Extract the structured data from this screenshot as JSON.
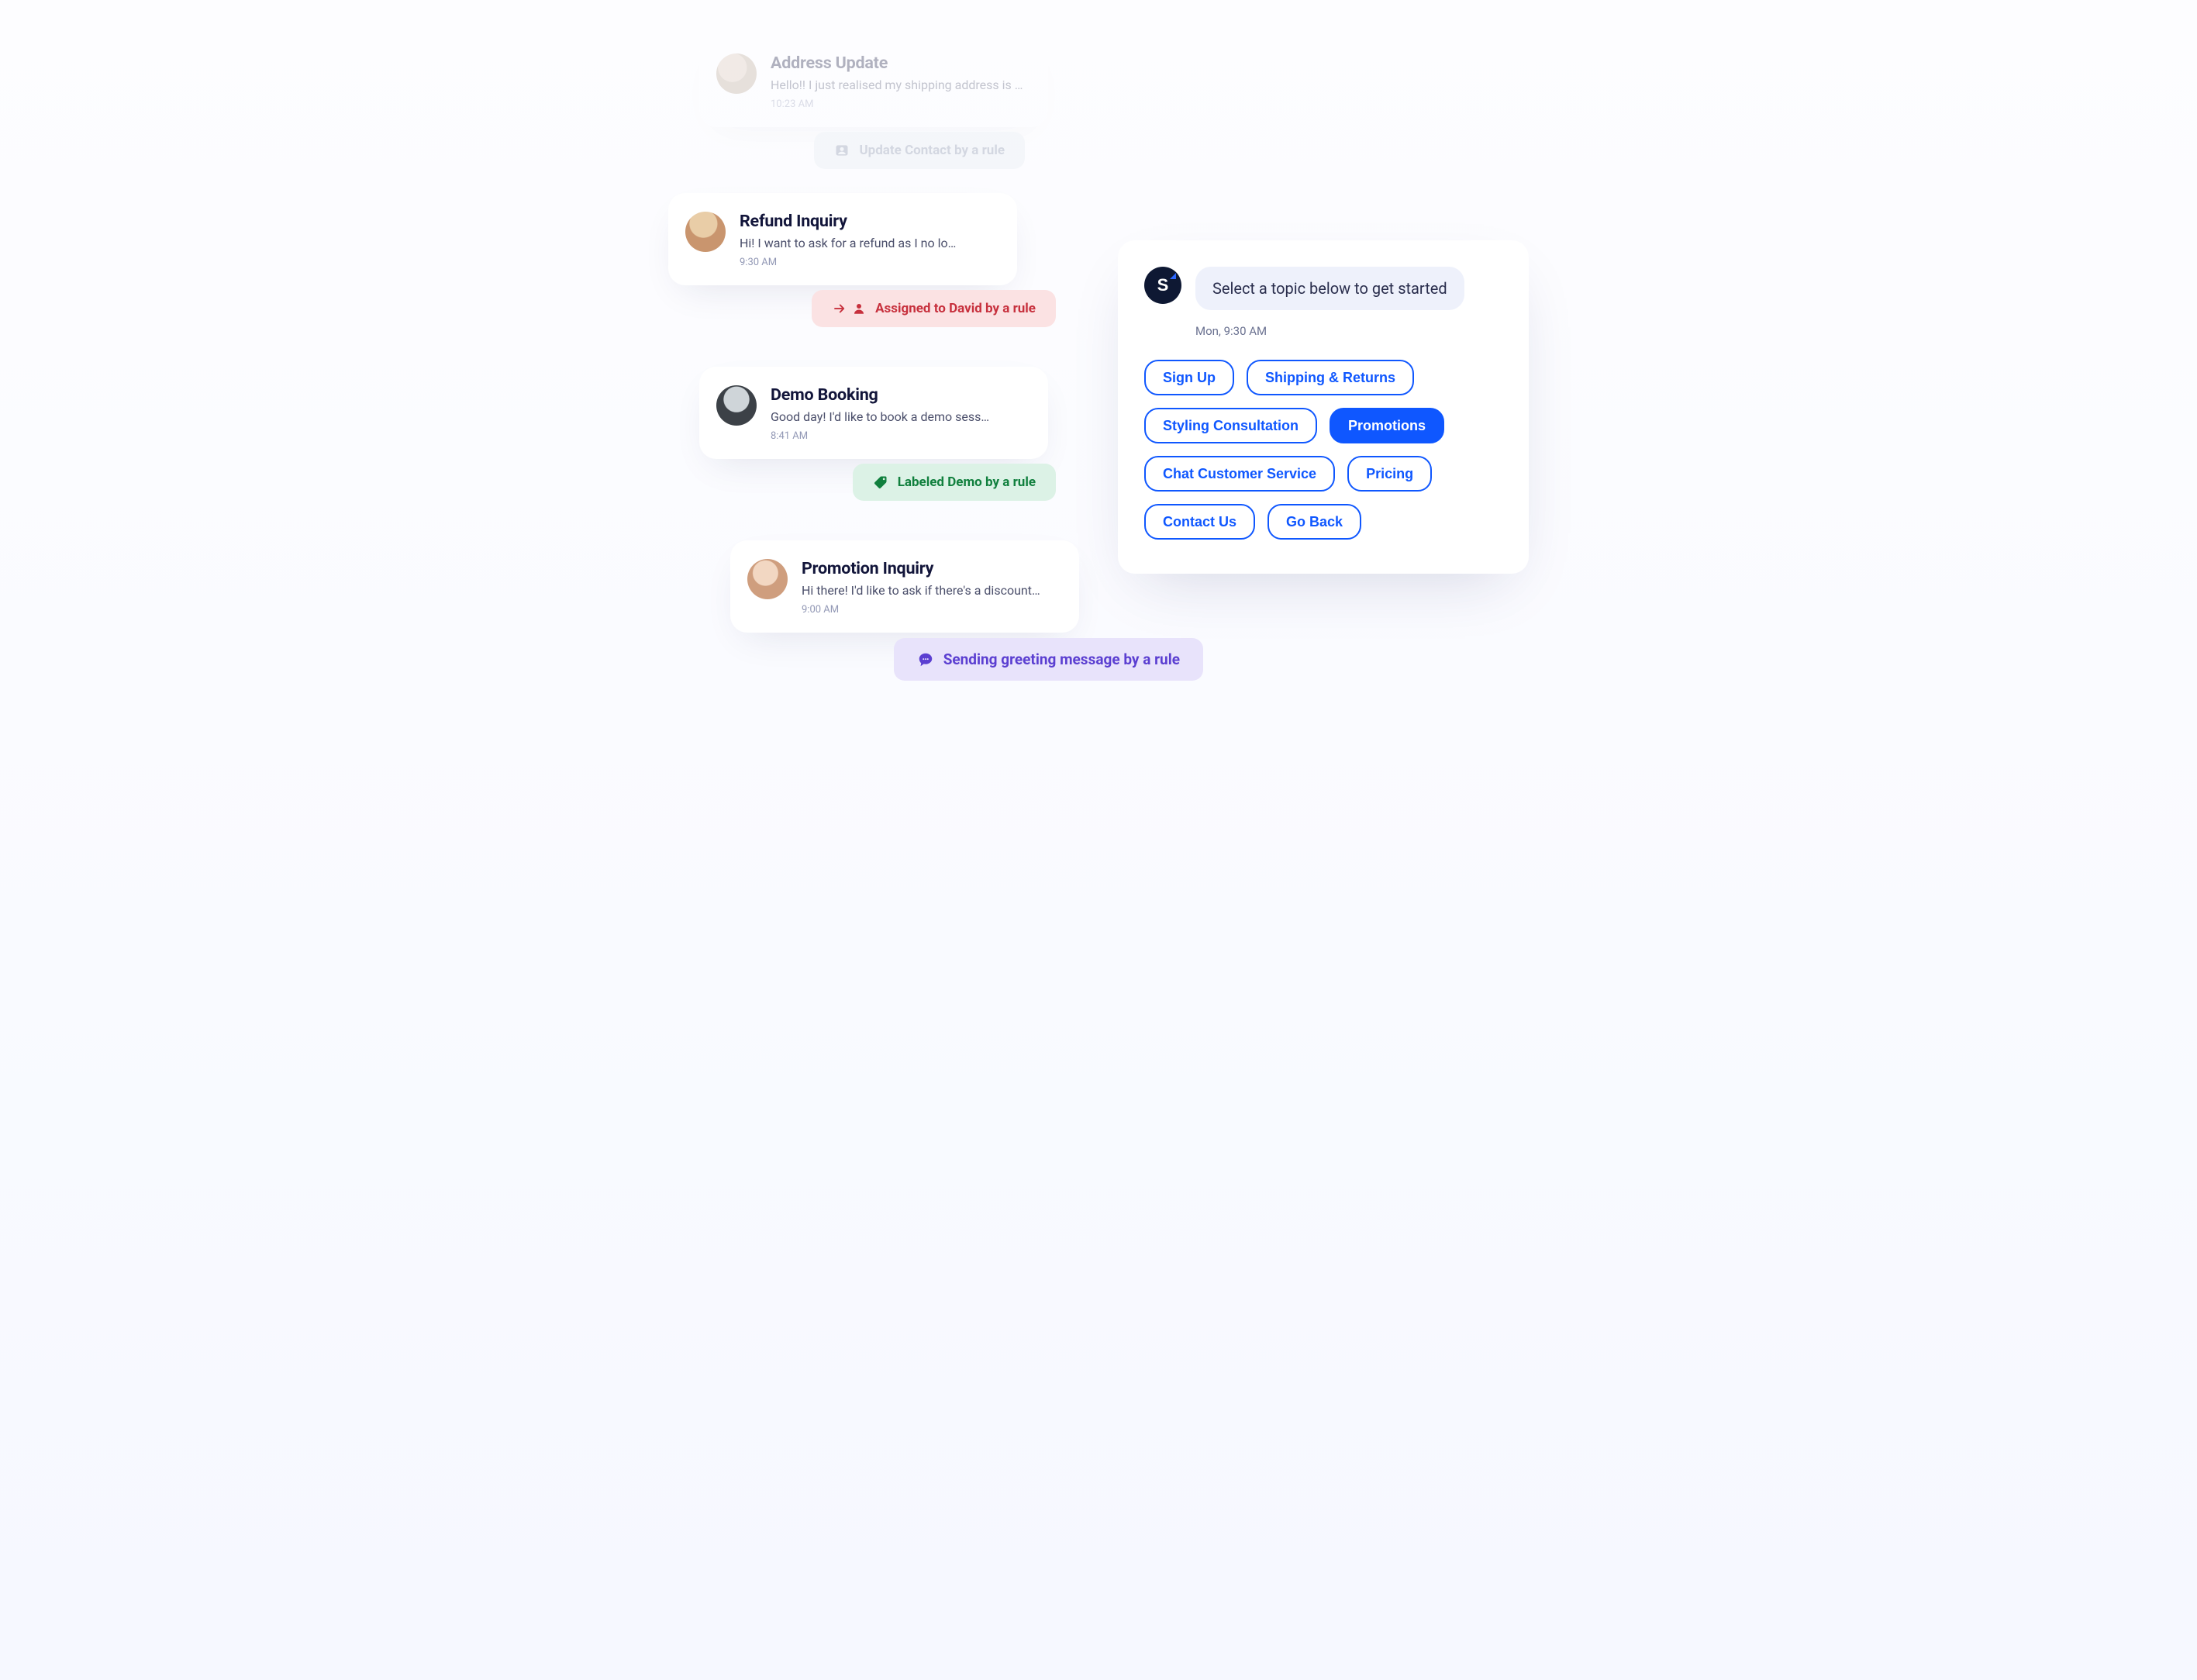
{
  "conversations": [
    {
      "title": "Address Update",
      "snippet": "Hello!! I just realised my shipping address is wrong…",
      "time": "10:23 AM",
      "rule_label": "Update Contact by a rule"
    },
    {
      "title": "Refund Inquiry",
      "snippet": "Hi! I want to ask for a refund as I no lo…",
      "time": "9:30 AM",
      "rule_label": "Assigned to David by a rule"
    },
    {
      "title": "Demo Booking",
      "snippet": "Good day! I'd like to book a demo sess…",
      "time": "8:41 AM",
      "rule_label": "Labeled Demo by a rule"
    },
    {
      "title": "Promotion Inquiry",
      "snippet": "Hi there! I'd like to ask if there's a discount…",
      "time": "9:00 AM",
      "rule_label": "Sending greeting message by a rule"
    }
  ],
  "topic": {
    "prompt": "Select a topic below to get started",
    "timestamp": "Mon, 9:30 AM",
    "options": [
      "Sign Up",
      "Shipping & Returns",
      "Styling Consultation",
      "Promotions",
      "Chat Customer Service",
      "Pricing",
      "Contact Us",
      "Go Back"
    ],
    "active_option": "Promotions",
    "brand_letter": "S"
  },
  "colors": {
    "accent": "#0f57ff",
    "rule_gray": "#7e8aa3",
    "rule_red": "#c7303d",
    "rule_green": "#11803e",
    "rule_purple": "#5b3fd1"
  }
}
